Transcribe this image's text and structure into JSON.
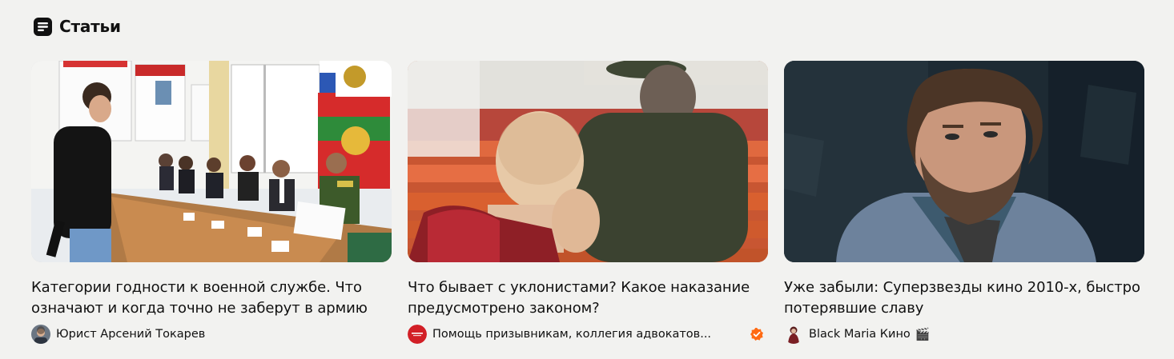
{
  "section": {
    "icon": "article-icon",
    "title": "Статьи"
  },
  "cards": [
    {
      "title": "Категории годности к военной службе. Что означают и когда точно не заберут в армию",
      "author": "Юрист Арсений Токарев",
      "thumbnail": "military-commission-photo",
      "avatar": "lawyer-avatar"
    },
    {
      "title": "Что бывает с уклонистами? Какое наказание предусмотрено законом?",
      "author": "Помощь призывникам, коллегия адвокатов...",
      "thumbnail": "conscript-hall-photo",
      "avatar": "lawyers-college-avatar",
      "verified": true,
      "verified_color": "#ff6a13"
    },
    {
      "title": "Уже забыли: Суперзвезды кино 2010-х, быстро потерявшие славу",
      "author": "Black Maria Кино",
      "author_emoji": "🎬",
      "thumbnail": "bearded-actor-photo",
      "avatar": "black-maria-avatar"
    }
  ]
}
